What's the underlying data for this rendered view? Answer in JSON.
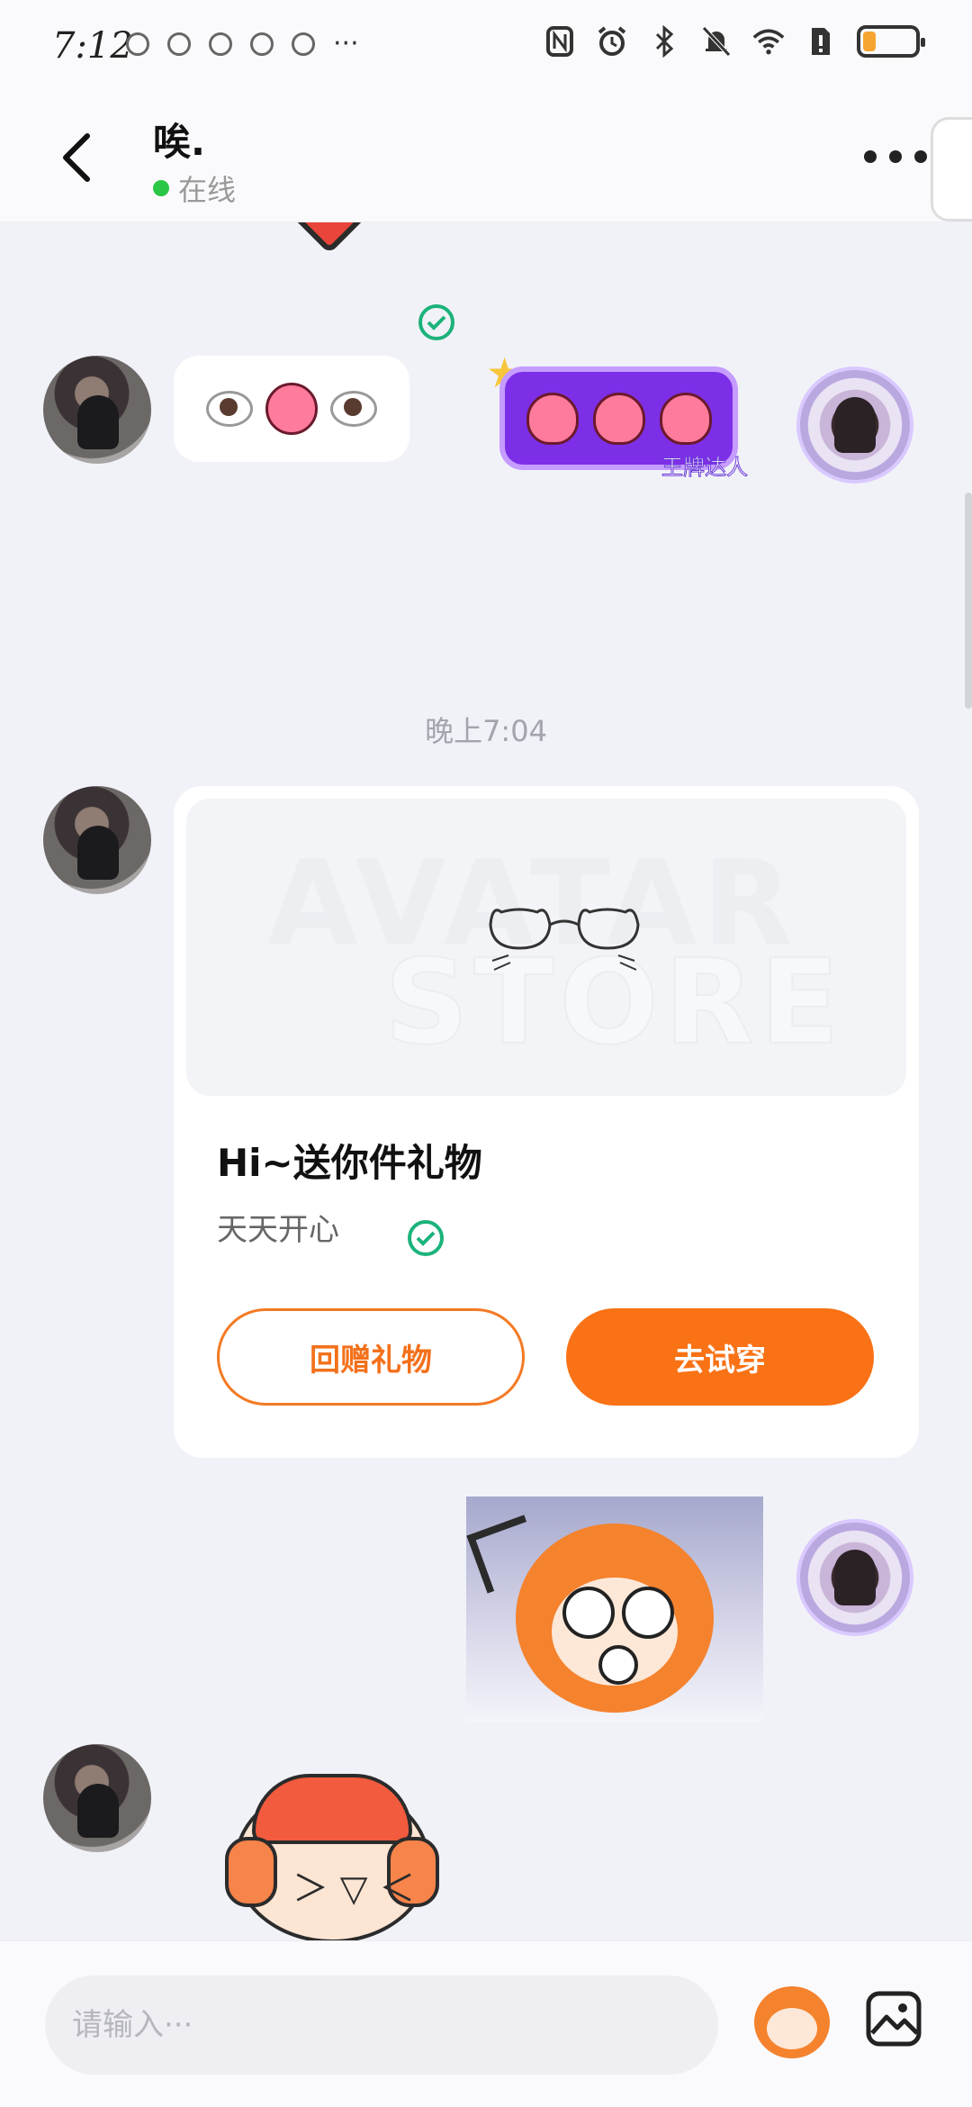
{
  "status_bar": {
    "time": "7:12",
    "more_notifications": "···",
    "battery_percent": 25
  },
  "header": {
    "peer_name": "唉.",
    "peer_status": "在线"
  },
  "messages": {
    "received_emoji_text": "👁️👅👁️",
    "timestamp": "晚上7:04",
    "sent_bubble_tag": "王牌达人"
  },
  "gift_card": {
    "banner_watermark_line1": "AVATAR",
    "banner_watermark_line2": "STORE",
    "title": "Hi~送你件礼物",
    "subtitle": "天天开心",
    "return_gift_label": "回赠礼物",
    "try_on_label": "去试穿"
  },
  "input": {
    "placeholder": "请输入···"
  },
  "colors": {
    "accent": "#f97215",
    "online": "#2bc646",
    "sent_check": "#1bb37a",
    "purple_bubble": "#7d2fe8"
  }
}
